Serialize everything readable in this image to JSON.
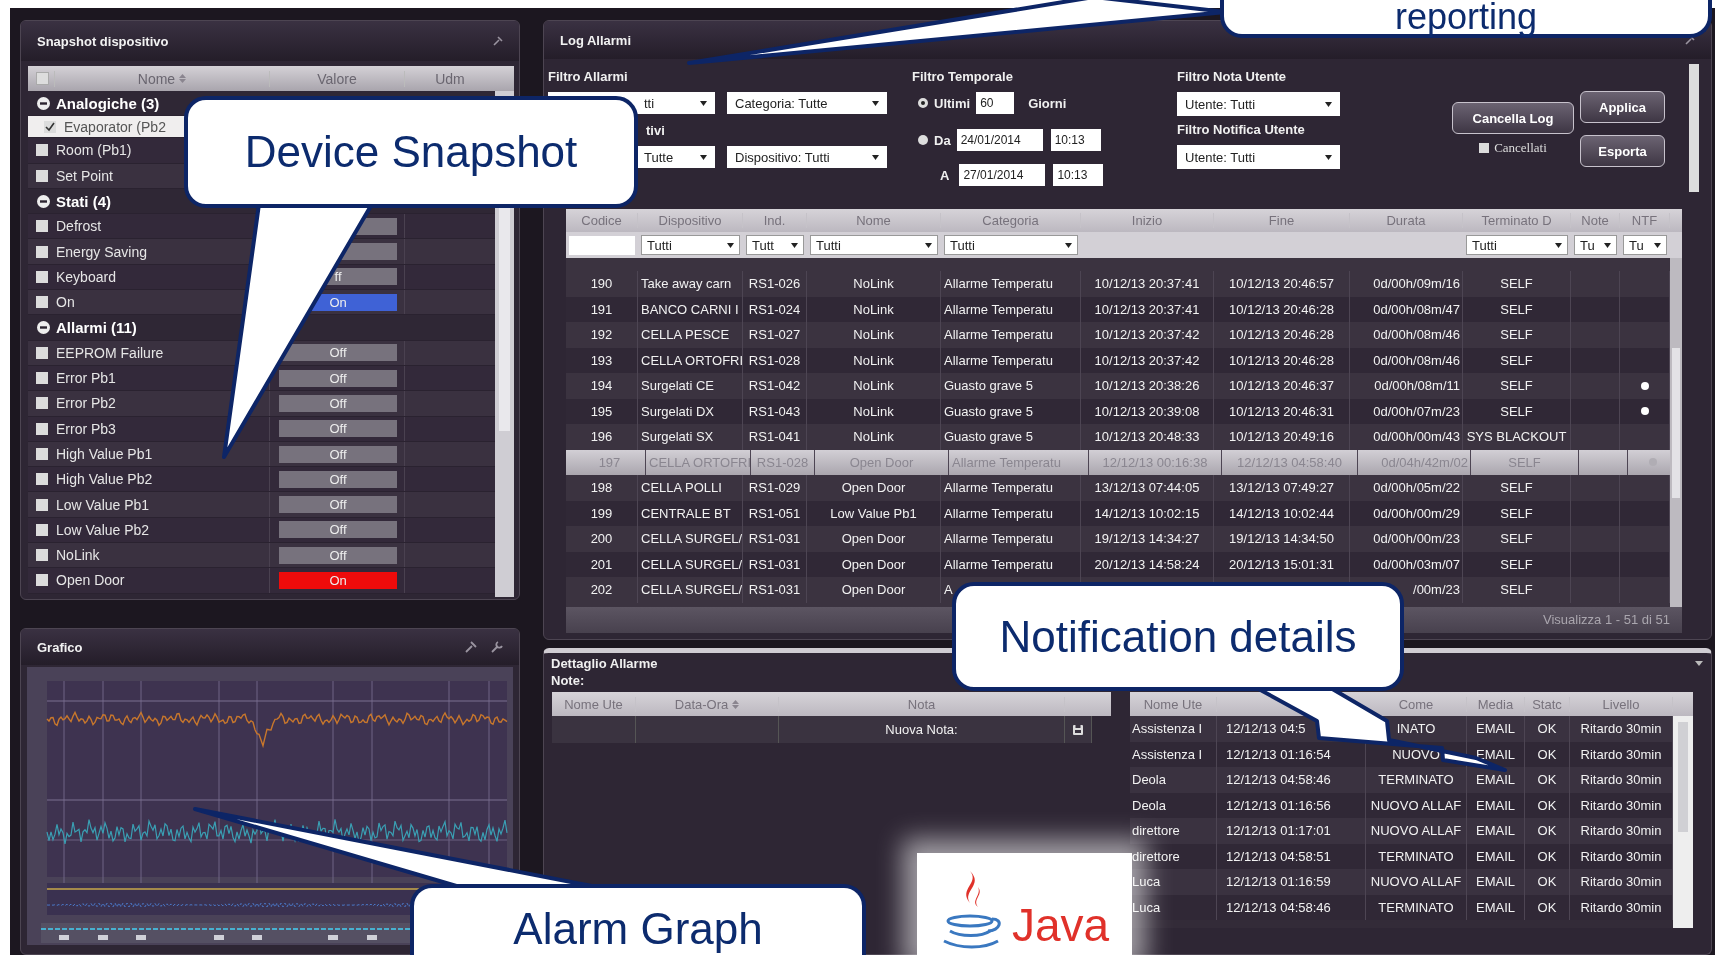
{
  "snapshot": {
    "title": "Snapshot dispositivo",
    "all_checked": false,
    "columns": [
      {
        "label": "Nome",
        "sorted": true
      },
      {
        "label": "Valore",
        "sorted": false
      },
      {
        "label": "Udm",
        "sorted": false
      }
    ],
    "groups": [
      {
        "label": "Analogiche (3)",
        "expanded": true,
        "items": [
          {
            "name": "Evaporator (Pb2",
            "checked": true,
            "selected": true
          },
          {
            "name": "Room (Pb1)",
            "checked": false,
            "selected": false
          },
          {
            "name": "Set Point",
            "checked": false,
            "selected": false
          }
        ]
      },
      {
        "label": "Stati (4)",
        "kind": "status",
        "expanded": true,
        "items": [
          {
            "name": "Defrost",
            "checked": false,
            "selected": false,
            "on": false
          },
          {
            "name": "Energy Saving",
            "checked": false,
            "selected": false,
            "on": false
          },
          {
            "name": "Keyboard",
            "checked": false,
            "selected": false,
            "on": false,
            "value": "ff"
          },
          {
            "name": "On",
            "checked": false,
            "selected": false,
            "on": true,
            "value": "On"
          }
        ]
      },
      {
        "label": "Allarmi (11)",
        "kind": "alarm",
        "expanded": true,
        "items": [
          {
            "name": "EEPROM Failure",
            "checked": false,
            "selected": false,
            "on": false,
            "value": "Off"
          },
          {
            "name": "Error Pb1",
            "checked": false,
            "selected": false,
            "on": false,
            "value": "Off"
          },
          {
            "name": "Error Pb2",
            "checked": false,
            "selected": false,
            "on": false,
            "value": "Off"
          },
          {
            "name": "Error Pb3",
            "checked": false,
            "selected": false,
            "on": false,
            "value": "Off"
          },
          {
            "name": "High Value Pb1",
            "checked": false,
            "selected": false,
            "on": false,
            "value": "Off"
          },
          {
            "name": "High Value Pb2",
            "checked": false,
            "selected": false,
            "on": false,
            "value": "Off"
          },
          {
            "name": "Low Value Pb1",
            "checked": false,
            "selected": false,
            "on": false,
            "value": "Off"
          },
          {
            "name": "Low Value Pb2",
            "checked": false,
            "selected": false,
            "on": false,
            "value": "Off"
          },
          {
            "name": "NoLink",
            "checked": false,
            "selected": false,
            "on": false,
            "value": "Off"
          },
          {
            "name": "Open Door",
            "checked": false,
            "selected": false,
            "on": true,
            "value": "On"
          }
        ]
      }
    ]
  },
  "graph": {
    "title": "Grafico"
  },
  "log": {
    "title": "Log Allarmi",
    "alarm_filter": {
      "label": "Filtro Allarmi",
      "row1": [
        "tti",
        "Categoria: Tutte"
      ],
      "sublabel": "tivi",
      "row2": [
        "Tutte",
        "Dispositivo: Tutti"
      ]
    },
    "time_filter": {
      "label": "Filtro Temporale",
      "last": {
        "selected": true,
        "label": "Ultimi",
        "value": "60",
        "unit": "Giorni"
      },
      "range": {
        "selected": false,
        "label": "Da",
        "date": "24/01/2014",
        "time": "10:13"
      },
      "to": {
        "label": "A",
        "date": "27/01/2014",
        "time": "10:13"
      }
    },
    "note_filter": {
      "label": "Filtro Nota Utente",
      "value": "Utente: Tutti"
    },
    "notify_filter": {
      "label": "Filtro Notifica Utente",
      "value": "Utente: Tutti"
    },
    "clear_button": "Cancella Log",
    "deleted": {
      "label": "Cancellati",
      "checked": false
    },
    "apply_button": "Applica",
    "export_button": "Esporta",
    "table": {
      "columns": [
        {
          "label": "Codice",
          "filter": {
            "kind": "text"
          }
        },
        {
          "label": "Dispositivo",
          "filter": {
            "kind": "select",
            "value": "Tutti"
          }
        },
        {
          "label": "Ind.",
          "filter": {
            "kind": "select",
            "value": "Tutt"
          }
        },
        {
          "label": "Nome",
          "filter": {
            "kind": "select",
            "value": "Tutti"
          }
        },
        {
          "label": "Categoria",
          "filter": {
            "kind": "select",
            "value": "Tutti"
          }
        },
        {
          "label": "Inizio"
        },
        {
          "label": "Fine"
        },
        {
          "label": "Durata"
        },
        {
          "label": "Terminato D",
          "filter": {
            "kind": "select",
            "value": "Tutti"
          }
        },
        {
          "label": "Note",
          "filter": {
            "kind": "select",
            "value": "Tu"
          }
        },
        {
          "label": "NTF",
          "filter": {
            "kind": "select",
            "value": "Tu"
          }
        }
      ],
      "rows": [
        {
          "selected": false,
          "ntf": false,
          "cells": [
            "190",
            "Take away carn",
            "RS1-026",
            "NoLink",
            "Allarme Temperatu",
            "10/12/13 20:37:41",
            "10/12/13 20:46:57",
            "0d/00h/09m/16",
            "SELF"
          ]
        },
        {
          "selected": false,
          "ntf": false,
          "cells": [
            "191",
            "BANCO CARNI I",
            "RS1-024",
            "NoLink",
            "Allarme Temperatu",
            "10/12/13 20:37:41",
            "10/12/13 20:46:28",
            "0d/00h/08m/47",
            "SELF"
          ]
        },
        {
          "selected": false,
          "ntf": false,
          "cells": [
            "192",
            "CELLA PESCE",
            "RS1-027",
            "NoLink",
            "Allarme Temperatu",
            "10/12/13 20:37:42",
            "10/12/13 20:46:28",
            "0d/00h/08m/46",
            "SELF"
          ]
        },
        {
          "selected": false,
          "ntf": false,
          "cells": [
            "193",
            "CELLA ORTOFRI",
            "RS1-028",
            "NoLink",
            "Allarme Temperatu",
            "10/12/13 20:37:42",
            "10/12/13 20:46:28",
            "0d/00h/08m/46",
            "SELF"
          ]
        },
        {
          "selected": false,
          "ntf": true,
          "cells": [
            "194",
            "Surgelati CE",
            "RS1-042",
            "NoLink",
            "Guasto grave 5",
            "10/12/13 20:38:26",
            "10/12/13 20:46:37",
            "0d/00h/08m/11",
            "SELF"
          ]
        },
        {
          "selected": false,
          "ntf": true,
          "cells": [
            "195",
            "Surgelati DX",
            "RS1-043",
            "NoLink",
            "Guasto grave 5",
            "10/12/13 20:39:08",
            "10/12/13 20:46:31",
            "0d/00h/07m/23",
            "SELF"
          ]
        },
        {
          "selected": false,
          "ntf": false,
          "cells": [
            "196",
            "Surgelati SX",
            "RS1-041",
            "NoLink",
            "Guasto grave 5",
            "10/12/13 20:48:33",
            "10/12/13 20:49:16",
            "0d/00h/00m/43",
            "SYS BLACKOUT"
          ]
        },
        {
          "selected": true,
          "ntf": true,
          "cells": [
            "197",
            "CELLA ORTOFRI",
            "RS1-028",
            "Open Door",
            "Allarme Temperatu",
            "12/12/13 00:16:38",
            "12/12/13 04:58:40",
            "0d/04h/42m/02",
            "SELF"
          ]
        },
        {
          "selected": false,
          "ntf": false,
          "cells": [
            "198",
            "CELLA POLLI",
            "RS1-029",
            "Open Door",
            "Allarme Temperatu",
            "13/12/13 07:44:05",
            "13/12/13 07:49:27",
            "0d/00h/05m/22",
            "SELF"
          ]
        },
        {
          "selected": false,
          "ntf": false,
          "cells": [
            "199",
            "CENTRALE BT",
            "RS1-051",
            "Low Value Pb1",
            "Allarme Temperatu",
            "14/12/13 10:02:15",
            "14/12/13 10:02:44",
            "0d/00h/00m/29",
            "SELF"
          ]
        },
        {
          "selected": false,
          "ntf": false,
          "cells": [
            "200",
            "CELLA SURGEL/",
            "RS1-031",
            "Open Door",
            "Allarme Temperatu",
            "19/12/13 14:34:27",
            "19/12/13 14:34:50",
            "0d/00h/00m/23",
            "SELF"
          ]
        },
        {
          "selected": false,
          "ntf": false,
          "cells": [
            "201",
            "CELLA SURGEL/",
            "RS1-031",
            "Open Door",
            "Allarme Temperatu",
            "20/12/13 14:58:24",
            "20/12/13 15:01:31",
            "0d/00h/03m/07",
            "SELF"
          ]
        },
        {
          "selected": false,
          "ntf": false,
          "cells": [
            "202",
            "CELLA SURGEL/",
            "RS1-031",
            "Open Door",
            "A",
            null,
            null,
            "/00m/23",
            "SELF"
          ]
        }
      ],
      "footer": "Visualizza 1 - 51 di 51"
    }
  },
  "detail": {
    "title": "Dettaglio Allarme",
    "notes_label": "Note:",
    "notes_columns": [
      {
        "label": "Nome Ute",
        "sorted": false
      },
      {
        "label": "Data-Ora",
        "sorted": true
      },
      {
        "label": "Nota",
        "sorted": false
      }
    ],
    "new_note": "Nuova Nota:",
    "notify_columns": [
      "Nome Ute",
      null,
      "Come",
      "Media",
      "Statc",
      "Livello"
    ],
    "notify_rows": [
      [
        "Assistenza I",
        "12/12/13 04:5",
        "INATO",
        "EMAIL",
        "OK",
        "Ritardo 30min"
      ],
      [
        "Assistenza I",
        "12/12/13 01:16:54",
        "NUOVO",
        "EMAIL",
        "OK",
        "Ritardo 30min"
      ],
      [
        "Deola",
        "12/12/13 04:58:46",
        "TERMINATO",
        "EMAIL",
        "OK",
        "Ritardo 30min"
      ],
      [
        "Deola",
        "12/12/13 01:16:56",
        "NUOVO ALLAF",
        "EMAIL",
        "OK",
        "Ritardo 30min"
      ],
      [
        "direttore",
        "12/12/13 01:17:01",
        "NUOVO ALLAF",
        "EMAIL",
        "OK",
        "Ritardo 30min"
      ],
      [
        "direttore",
        "12/12/13 04:58:51",
        "TERMINATO",
        "EMAIL",
        "OK",
        "Ritardo 30min"
      ],
      [
        "Luca",
        "12/12/13 01:16:59",
        "NUOVO ALLAF",
        "EMAIL",
        "OK",
        "Ritardo 30min"
      ],
      [
        "Luca",
        "12/12/13 04:58:46",
        "TERMINATO",
        "EMAIL",
        "OK",
        "Ritardo 30min"
      ]
    ]
  },
  "logo": {
    "text": "Java"
  },
  "callouts": [
    {
      "kind": "reporting",
      "text": "reporting"
    },
    {
      "kind": "snapshot",
      "text": "Device Snapshot"
    },
    {
      "kind": "notification",
      "text": "Notification details"
    },
    {
      "kind": "graph",
      "text": "Alarm Graph"
    }
  ]
}
